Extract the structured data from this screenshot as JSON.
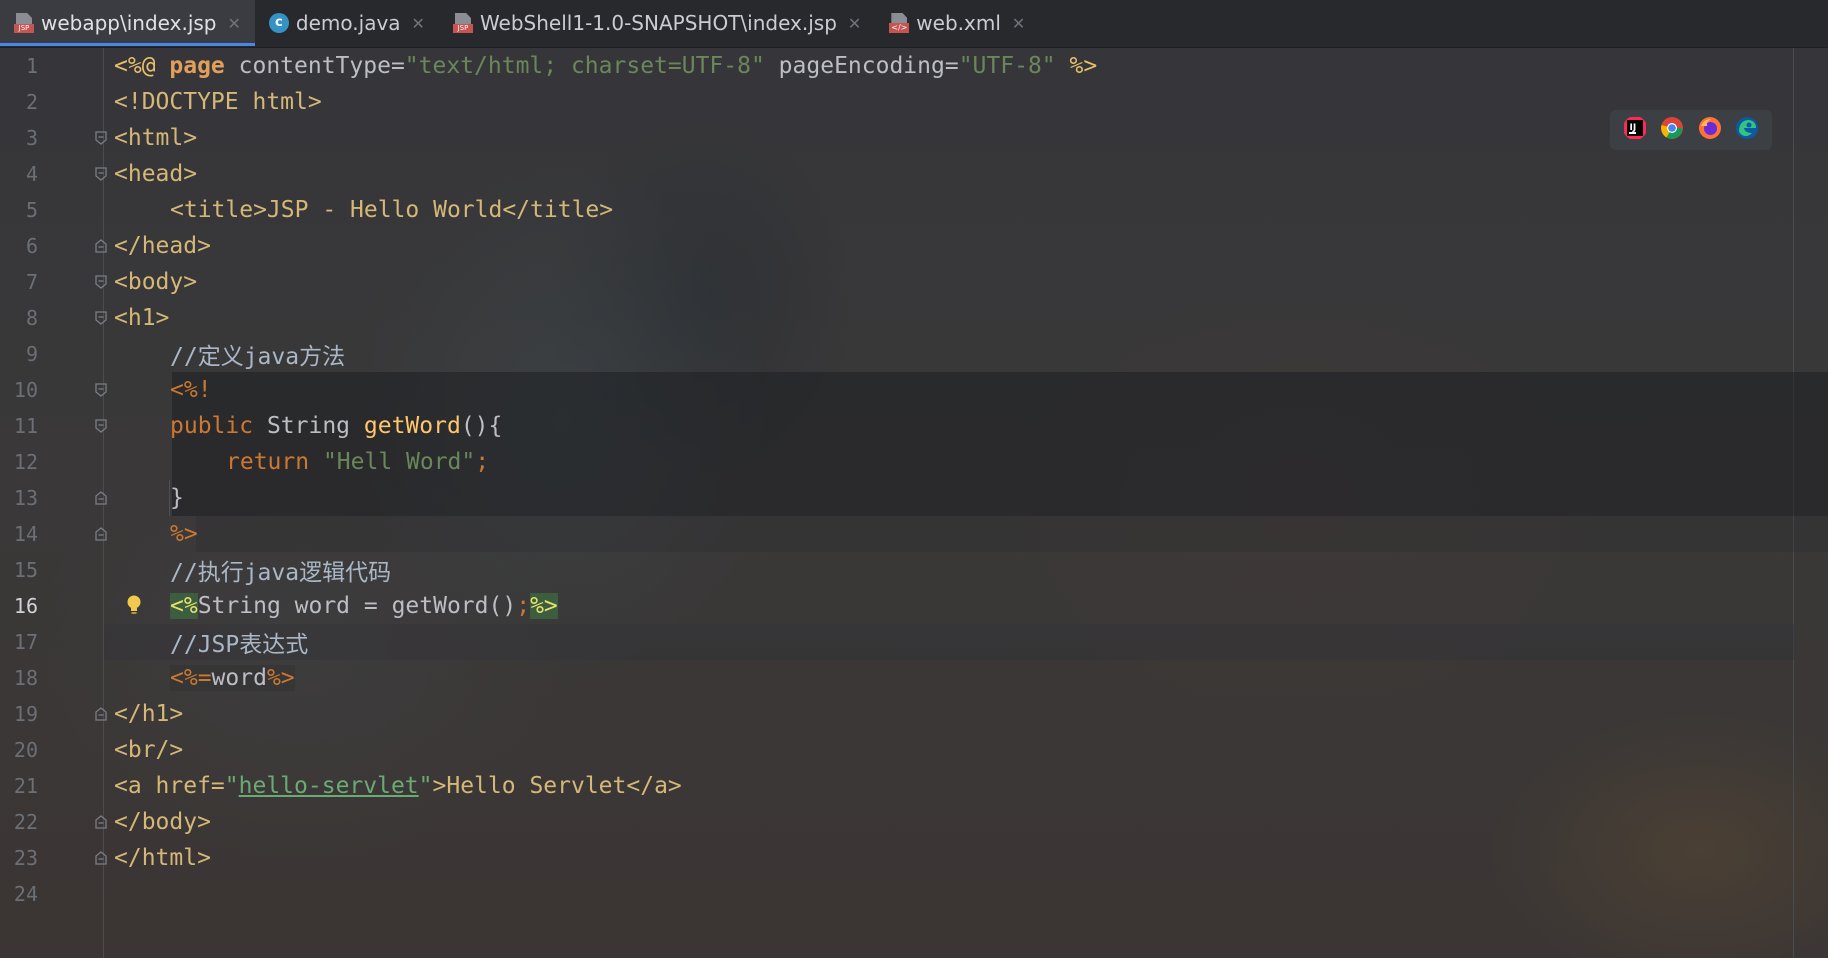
{
  "tabs": [
    {
      "label": "webapp\\index.jsp",
      "icon": "jsp-file-icon",
      "active": true
    },
    {
      "label": "demo.java",
      "icon": "java-class-icon",
      "active": false
    },
    {
      "label": "WebShell1-1.0-SNAPSHOT\\index.jsp",
      "icon": "jsp-file-icon",
      "active": false
    },
    {
      "label": "web.xml",
      "icon": "xml-file-icon",
      "active": false
    }
  ],
  "editor": {
    "current_line": "16",
    "lines": [
      {
        "n": "1"
      },
      {
        "n": "2"
      },
      {
        "n": "3"
      },
      {
        "n": "4"
      },
      {
        "n": "5"
      },
      {
        "n": "6"
      },
      {
        "n": "7"
      },
      {
        "n": "8"
      },
      {
        "n": "9"
      },
      {
        "n": "10"
      },
      {
        "n": "11"
      },
      {
        "n": "12"
      },
      {
        "n": "13"
      },
      {
        "n": "14"
      },
      {
        "n": "15"
      },
      {
        "n": "16"
      },
      {
        "n": "17"
      },
      {
        "n": "18"
      },
      {
        "n": "19"
      },
      {
        "n": "20"
      },
      {
        "n": "21"
      },
      {
        "n": "22"
      },
      {
        "n": "23"
      },
      {
        "n": "24"
      }
    ],
    "code": {
      "l1_a": "<%@ ",
      "l1_b": "page",
      "l1_c": " contentType=",
      "l1_d": "\"text/html; charset=UTF-8\"",
      "l1_e": " pageEncoding=",
      "l1_f": "\"UTF-8\"",
      "l1_g": " %>",
      "l2": "<!DOCTYPE html>",
      "l3": "<html>",
      "l4": "<head>",
      "l5": "<title>JSP - Hello World</title>",
      "l6": "</head>",
      "l7": "<body>",
      "l8": "<h1>",
      "l9": "//定义java方法",
      "l10": "<%!",
      "l11_a": "public ",
      "l11_b": "String ",
      "l11_c": "getWord",
      "l11_d": "(){",
      "l12_a": "return ",
      "l12_b": "\"Hell Word\"",
      "l12_c": ";",
      "l13": "}",
      "l14": "%>",
      "l15": "//执行java逻辑代码",
      "l16_a": "<%",
      "l16_b": "String word = getWord()",
      "l16_c": ";",
      "l16_d": "%>",
      "l17": "//JSP表达式",
      "l18_a": "<%=",
      "l18_b": "word",
      "l18_c": "%>",
      "l19": "</h1>",
      "l20": "<br/>",
      "l21_a": "<a href=",
      "l21_b": "\"",
      "l21_c": "hello-servlet",
      "l21_d": "\"",
      "l21_e": ">Hello Servlet</a>",
      "l22": "</body>",
      "l23": "</html>"
    }
  },
  "browser_icons": [
    "intellij-icon",
    "chrome-icon",
    "firefox-icon",
    "edge-icon"
  ],
  "colors": {
    "active_tab_underline": "#4a86e8",
    "tag": "#e8bf6a",
    "keyword": "#cc7832",
    "string": "#6a8759",
    "function": "#ffc66d"
  }
}
